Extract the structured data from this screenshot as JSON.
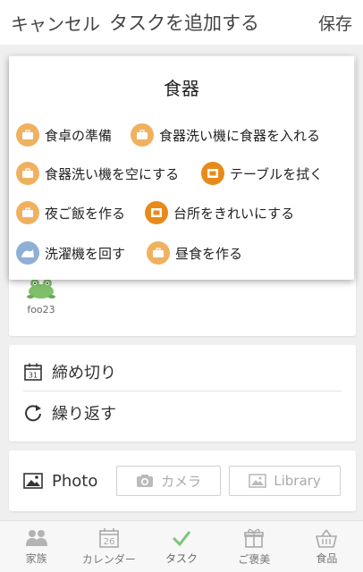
{
  "header": {
    "cancel_label": "キャンセル",
    "title": "タスクを追加する",
    "save_label": "保存"
  },
  "assignee": {
    "name": "foo23"
  },
  "deadline": {
    "label": "締め切り",
    "calendar_day": "31"
  },
  "repeat": {
    "label": "繰り返す"
  },
  "photo": {
    "label": "Photo",
    "camera_label": "カメラ",
    "library_label": "Library"
  },
  "overlay": {
    "title": "食器",
    "items": [
      {
        "label": "食卓の準備",
        "icon": "briefcase-icon",
        "color": "#f0b15f"
      },
      {
        "label": "食器洗い機に食器を入れる",
        "icon": "briefcase-icon",
        "color": "#f0b15f"
      },
      {
        "label": "食器洗い機を空にする",
        "icon": "briefcase-icon",
        "color": "#f0b15f"
      },
      {
        "label": "テーブルを拭く",
        "icon": "cloth-icon",
        "color": "#e88a1a"
      },
      {
        "label": "夜ご飯を作る",
        "icon": "briefcase-icon",
        "color": "#f0b15f"
      },
      {
        "label": "台所をきれいにする",
        "icon": "cloth-icon",
        "color": "#e88a1a"
      },
      {
        "label": "洗濯機を回す",
        "icon": "wave-icon",
        "color": "#8fb0d6"
      },
      {
        "label": "昼食を作る",
        "icon": "briefcase-icon",
        "color": "#f0b15f"
      }
    ]
  },
  "tabs": [
    {
      "label": "家族",
      "icon": "family-icon"
    },
    {
      "label": "カレンダー",
      "icon": "calendar-icon",
      "day": "26"
    },
    {
      "label": "タスク",
      "icon": "check-icon",
      "active": true
    },
    {
      "label": "ご褒美",
      "icon": "gift-icon"
    },
    {
      "label": "食品",
      "icon": "basket-icon"
    }
  ],
  "colors": {
    "accent_green": "#7cc576",
    "orange": "#f0b15f",
    "dark_orange": "#e88a1a",
    "blue": "#8fb0d6"
  }
}
